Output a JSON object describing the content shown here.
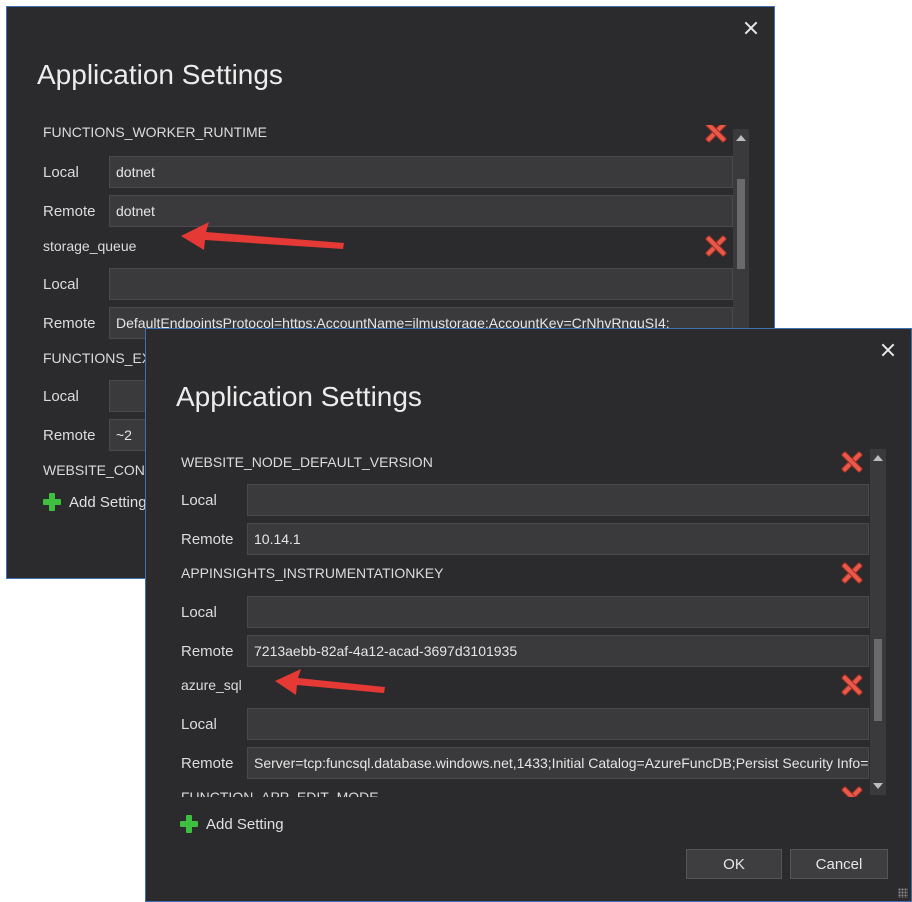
{
  "dialog_back": {
    "title": "Application Settings",
    "settings": [
      {
        "name": "FUNCTIONS_WORKER_RUNTIME",
        "local_label": "Local",
        "local_value": "dotnet",
        "remote_label": "Remote",
        "remote_value": "dotnet"
      },
      {
        "name": "storage_queue",
        "local_label": "Local",
        "local_value": "",
        "remote_label": "Remote",
        "remote_value": "DefaultEndpointsProtocol=https;AccountName=ilmustorage;AccountKey=CrNhvRnquSI4;"
      },
      {
        "name": "FUNCTIONS_EXTENSION_VERSION",
        "local_label": "Local",
        "local_value": "",
        "remote_label": "Remote",
        "remote_value": "~2"
      },
      {
        "name": "WEBSITE_CONTENTSHARE"
      }
    ],
    "add_setting_label": "Add Setting"
  },
  "dialog_front": {
    "title": "Application Settings",
    "settings": [
      {
        "name": "WEBSITE_NODE_DEFAULT_VERSION",
        "local_label": "Local",
        "local_value": "",
        "remote_label": "Remote",
        "remote_value": "10.14.1"
      },
      {
        "name": "APPINSIGHTS_INSTRUMENTATIONKEY",
        "local_label": "Local",
        "local_value": "",
        "remote_label": "Remote",
        "remote_value": "7213aebb-82af-4a12-acad-3697d3101935"
      },
      {
        "name": "azure_sql",
        "local_label": "Local",
        "local_value": "",
        "remote_label": "Remote",
        "remote_value": "Server=tcp:funcsql.database.windows.net,1433;Initial Catalog=AzureFuncDB;Persist Security Info=False;"
      },
      {
        "name": "FUNCTION_APP_EDIT_MODE"
      }
    ],
    "add_setting_label": "Add Setting",
    "ok_label": "OK",
    "cancel_label": "Cancel"
  },
  "colors": {
    "dialog_bg": "#2b2b2d",
    "field_bg": "#3a3a3c",
    "border_accent": "#3e6fb0",
    "delete_red": "#e8594a",
    "add_green": "#3fbf3f",
    "annotation_arrow": "#e53935"
  },
  "icons": [
    "close-icon",
    "delete-icon",
    "plus-icon",
    "scroll-up-icon",
    "scroll-down-icon",
    "annotation-arrow"
  ]
}
